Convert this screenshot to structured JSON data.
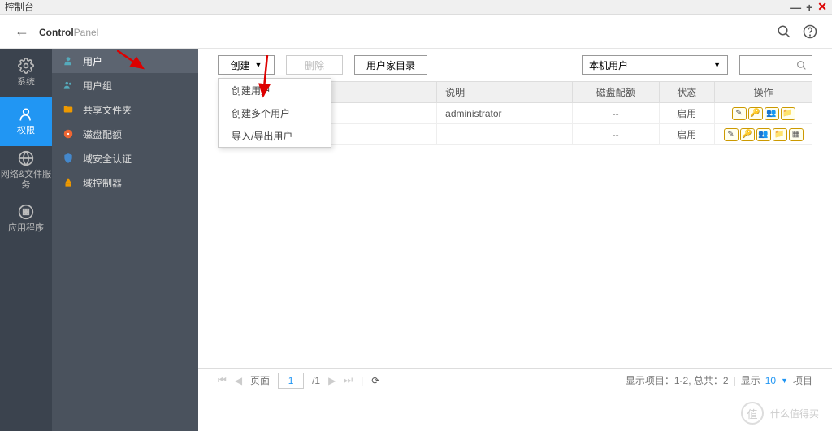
{
  "window": {
    "title": "控制台"
  },
  "header": {
    "title_bold": "Control",
    "title_light": "Panel"
  },
  "iconSidebar": [
    {
      "label": "系统"
    },
    {
      "label": "权限"
    },
    {
      "label": "网络&文件服务"
    },
    {
      "label": "应用程序"
    }
  ],
  "subSidebar": [
    {
      "label": "用户"
    },
    {
      "label": "用户组"
    },
    {
      "label": "共享文件夹"
    },
    {
      "label": "磁盘配额"
    },
    {
      "label": "域安全认证"
    },
    {
      "label": "域控制器"
    }
  ],
  "toolbar": {
    "create": "创建",
    "delete": "删除",
    "home_dir": "用户家目录",
    "select_value": "本机用户"
  },
  "dropdown": {
    "items": [
      "创建用户",
      "创建多个用户",
      "导入/导出用户"
    ]
  },
  "table": {
    "headers": {
      "desc": "说明",
      "quota": "磁盘配额",
      "status": "状态",
      "action": "操作"
    },
    "rows": [
      {
        "desc": "administrator",
        "quota": "--",
        "status": "启用"
      },
      {
        "desc": "",
        "quota": "--",
        "status": "启用"
      }
    ]
  },
  "footer": {
    "page_label": "页面",
    "page_value": "1",
    "page_total": "/1",
    "summary_left": "显示项目：1-2, 总共：2",
    "show_label": "显示",
    "show_value": "10",
    "items_label": "项目"
  },
  "watermark": "什么值得买"
}
